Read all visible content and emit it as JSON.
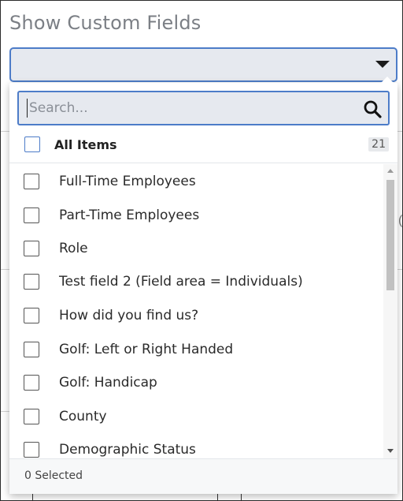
{
  "page": {
    "title": "Show Custom Fields"
  },
  "select": {
    "value": ""
  },
  "search": {
    "placeholder": "Search...",
    "value": ""
  },
  "all_items": {
    "label": "All Items",
    "count": "21",
    "checked": false
  },
  "items": [
    {
      "label": "Full-Time Employees",
      "checked": false
    },
    {
      "label": "Part-Time Employees",
      "checked": false
    },
    {
      "label": "Role",
      "checked": false
    },
    {
      "label": "Test field 2 (Field area = Individuals)",
      "checked": false
    },
    {
      "label": "How did you find us?",
      "checked": false
    },
    {
      "label": "Golf: Left or Right Handed",
      "checked": false
    },
    {
      "label": "Golf: Handicap",
      "checked": false
    },
    {
      "label": "County",
      "checked": false
    },
    {
      "label": "Demographic Status",
      "checked": false
    }
  ],
  "footer": {
    "status": "0 Selected"
  },
  "colors": {
    "accent": "#4d7cc8",
    "field_bg": "#e6e9ef",
    "title_gray": "#7b7f85"
  },
  "icons": {
    "search": "search-icon",
    "caret": "caret-down-icon"
  }
}
